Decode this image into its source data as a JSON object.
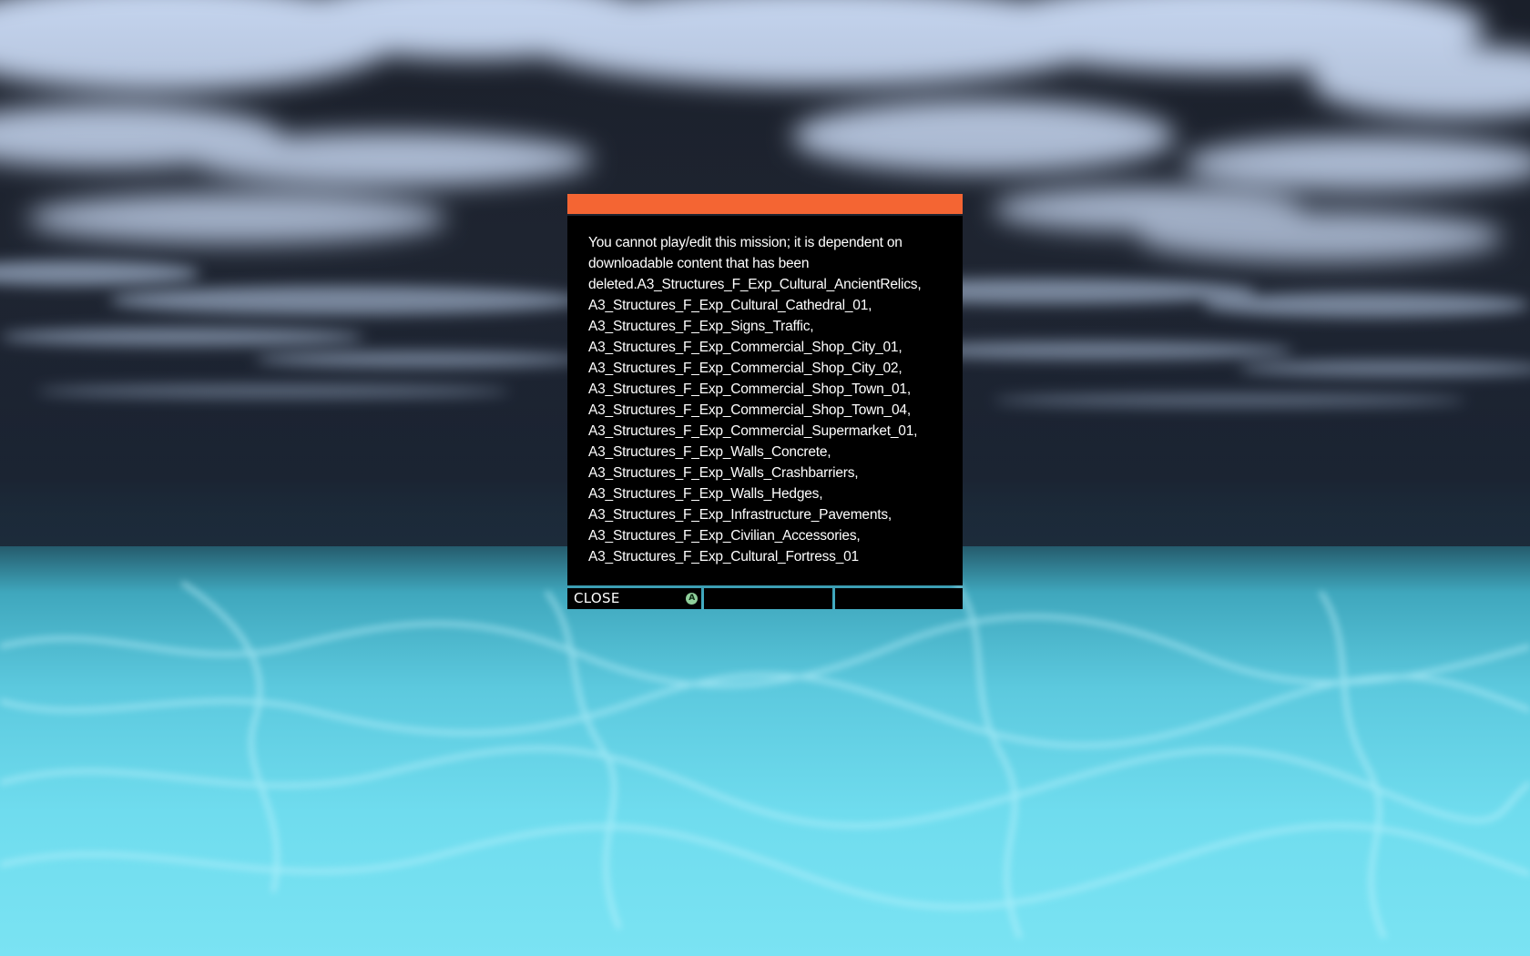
{
  "dialog": {
    "accent_color": "#f46533",
    "message_lines": [
      "You cannot play/edit this mission; it is dependent on",
      "downloadable content that has been",
      "deleted.A3_Structures_F_Exp_Cultural_AncientRelics,",
      "A3_Structures_F_Exp_Cultural_Cathedral_01,",
      "A3_Structures_F_Exp_Signs_Traffic,",
      "A3_Structures_F_Exp_Commercial_Shop_City_01,",
      "A3_Structures_F_Exp_Commercial_Shop_City_02,",
      "A3_Structures_F_Exp_Commercial_Shop_Town_01,",
      "A3_Structures_F_Exp_Commercial_Shop_Town_04,",
      "A3_Structures_F_Exp_Commercial_Supermarket_01,",
      "A3_Structures_F_Exp_Walls_Concrete,",
      "A3_Structures_F_Exp_Walls_Crashbarriers,",
      "A3_Structures_F_Exp_Walls_Hedges,",
      "A3_Structures_F_Exp_Infrastructure_Pavements,",
      "A3_Structures_F_Exp_Civilian_Accessories,",
      "A3_Structures_F_Exp_Cultural_Fortress_01"
    ],
    "buttons": {
      "close_label": "CLOSE",
      "close_hint_icon": "a-button-icon",
      "close_hint_glyph": "A"
    }
  }
}
